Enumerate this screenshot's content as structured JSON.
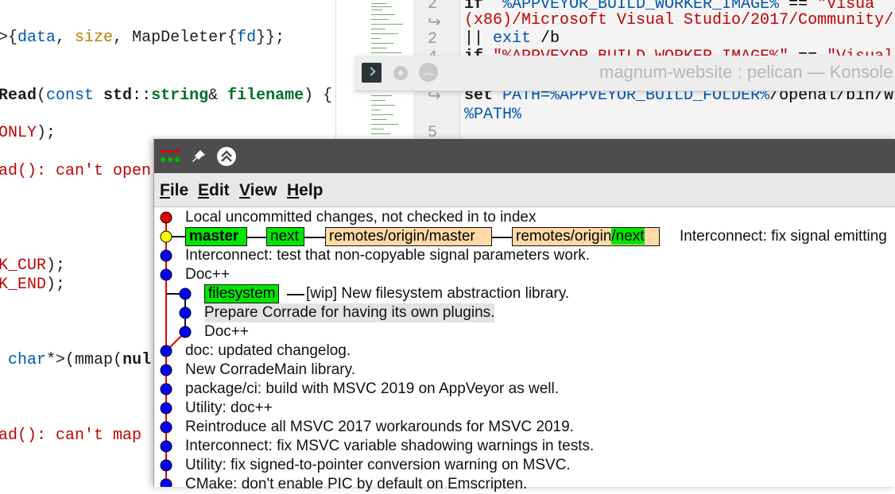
{
  "left_editor": {
    "lines": [
      {
        "parts": [
          [
            ">{",
            "k0"
          ],
          [
            "data",
            "par"
          ],
          [
            ", ",
            "k0"
          ],
          [
            "size",
            "num"
          ],
          [
            ", ",
            "k0"
          ],
          [
            "MapDeleter",
            "k0"
          ],
          [
            "{",
            "k0"
          ],
          [
            "fd",
            "par"
          ],
          [
            "}};",
            "k0"
          ]
        ]
      },
      {
        "parts": [
          [
            "Read",
            "kb"
          ],
          [
            "(",
            "k0"
          ],
          [
            "const ",
            "ty"
          ],
          [
            "std",
            "kb"
          ],
          [
            "::",
            "k0"
          ],
          [
            "string",
            "var"
          ],
          [
            "& ",
            "k0"
          ],
          [
            "filename",
            "var"
          ],
          [
            ") {",
            "k0"
          ]
        ]
      },
      {
        "parts": [
          [
            "ONLY",
            "str"
          ],
          [
            ");",
            "k0"
          ]
        ]
      },
      {
        "parts": [
          [
            "ad(): can't open",
            "str"
          ]
        ]
      },
      {
        "parts": [
          [
            "K_CUR",
            "str"
          ],
          [
            ");",
            "k0"
          ]
        ]
      },
      {
        "parts": [
          [
            "K_END",
            "str"
          ],
          [
            ");",
            "k0"
          ]
        ]
      },
      {
        "parts": [
          [
            " char",
            "ty"
          ],
          [
            "*>(",
            "k0"
          ],
          [
            "mmap",
            "k0"
          ],
          [
            "(",
            "k0"
          ],
          [
            "nul",
            "kb"
          ]
        ]
      },
      {
        "parts": [
          [
            "ad(): can't map ",
            "str"
          ]
        ]
      }
    ]
  },
  "right_editor": {
    "gutter": [
      "2",
      "↪",
      "2",
      "4",
      "↪",
      "5"
    ],
    "lines": [
      {
        "parts": [
          [
            "if ",
            "kb"
          ],
          [
            " %APPVEYOR_BUILD_WORKER_IMAGE%",
            "par"
          ],
          [
            " == ",
            "k0"
          ],
          [
            "\"Visua",
            "str"
          ]
        ]
      },
      {
        "parts": [
          [
            "(x86)/Microsoft Visual Studio/2017/Community/",
            "str"
          ]
        ]
      },
      {
        "parts": [
          [
            "|| ",
            "k0"
          ],
          [
            "exit",
            "ty"
          ],
          [
            " /b",
            "k0"
          ]
        ]
      },
      {
        "parts": [
          [
            "if ",
            "kb"
          ],
          [
            "\"%APPVEYOR_BUILD_WORKER_IMAGE%\"",
            "str"
          ],
          [
            " == ",
            "k0"
          ],
          [
            "\"Visual",
            "str"
          ]
        ]
      },
      {
        "parts": [
          [
            "set ",
            "kb"
          ],
          [
            "PATH=%APPVEYOR_BUILD_FOLDER%",
            "par"
          ],
          [
            "/openal/bin/W",
            "k0"
          ]
        ]
      },
      {
        "parts": [
          [
            "%PATH%",
            "par"
          ]
        ]
      }
    ]
  },
  "konsole": {
    "title": "magnum-website : pelican — Konsole"
  },
  "gitk": {
    "menus": [
      {
        "label": "File",
        "underline": "F",
        "rest": "ile"
      },
      {
        "label": "Edit",
        "underline": "E",
        "rest": "dit"
      },
      {
        "label": "View",
        "underline": "V",
        "rest": "iew"
      },
      {
        "label": "Help",
        "underline": "H",
        "rest": "elp"
      }
    ],
    "commits": [
      {
        "text": "Local uncommitted changes, not checked in to index",
        "dot": "#e00000",
        "lane": 0
      },
      {
        "text": "Interconnect: fix signal emitting",
        "dot": "#ffff00",
        "lane": 0,
        "refs": true
      },
      {
        "text": "Interconnect: test that non-copyable signal parameters work.",
        "dot": "#0000ff",
        "lane": 0
      },
      {
        "text": "Doc++",
        "dot": "#0000ff",
        "lane": 0
      },
      {
        "text": "[wip] New filesystem abstraction library.",
        "dot": "#0000ff",
        "lane": 1,
        "branch": "filesystem"
      },
      {
        "text": "Prepare Corrade for having its own plugins.",
        "dot": "#0000ff",
        "lane": 1,
        "highlight": true
      },
      {
        "text": "Doc++",
        "dot": "#0000ff",
        "lane": 1
      },
      {
        "text": "doc: updated changelog.",
        "dot": "#0000ff",
        "lane": 0
      },
      {
        "text": "New CorradeMain library.",
        "dot": "#0000ff",
        "lane": 0
      },
      {
        "text": "package/ci: build with MSVC 2019 on AppVeyor as well.",
        "dot": "#0000ff",
        "lane": 0
      },
      {
        "text": "Utility: doc++",
        "dot": "#0000ff",
        "lane": 0
      },
      {
        "text": "Reintroduce all MSVC 2017 workarounds for MSVC 2019.",
        "dot": "#0000ff",
        "lane": 0
      },
      {
        "text": "Interconnect: fix MSVC variable shadowing warnings in tests.",
        "dot": "#0000ff",
        "lane": 0
      },
      {
        "text": "Utility: fix signed-to-pointer conversion warning on MSVC.",
        "dot": "#0000ff",
        "lane": 0
      },
      {
        "text": "CMake: don't enable PIC by default on Emscripten.",
        "dot": "#0000ff",
        "lane": 0
      }
    ],
    "refs": {
      "master": "master",
      "next": "next",
      "remote_master_prefix": "remotes/origin",
      "remote_master_name": "/master",
      "remote_next_prefix": "remotes/origin",
      "remote_next_name": "/next"
    },
    "colors": {
      "local_branch": "#00e600",
      "remote_branch": "#ffd9a6",
      "graph_line": "#e00000",
      "titlebar": "#4d4d4d"
    }
  }
}
